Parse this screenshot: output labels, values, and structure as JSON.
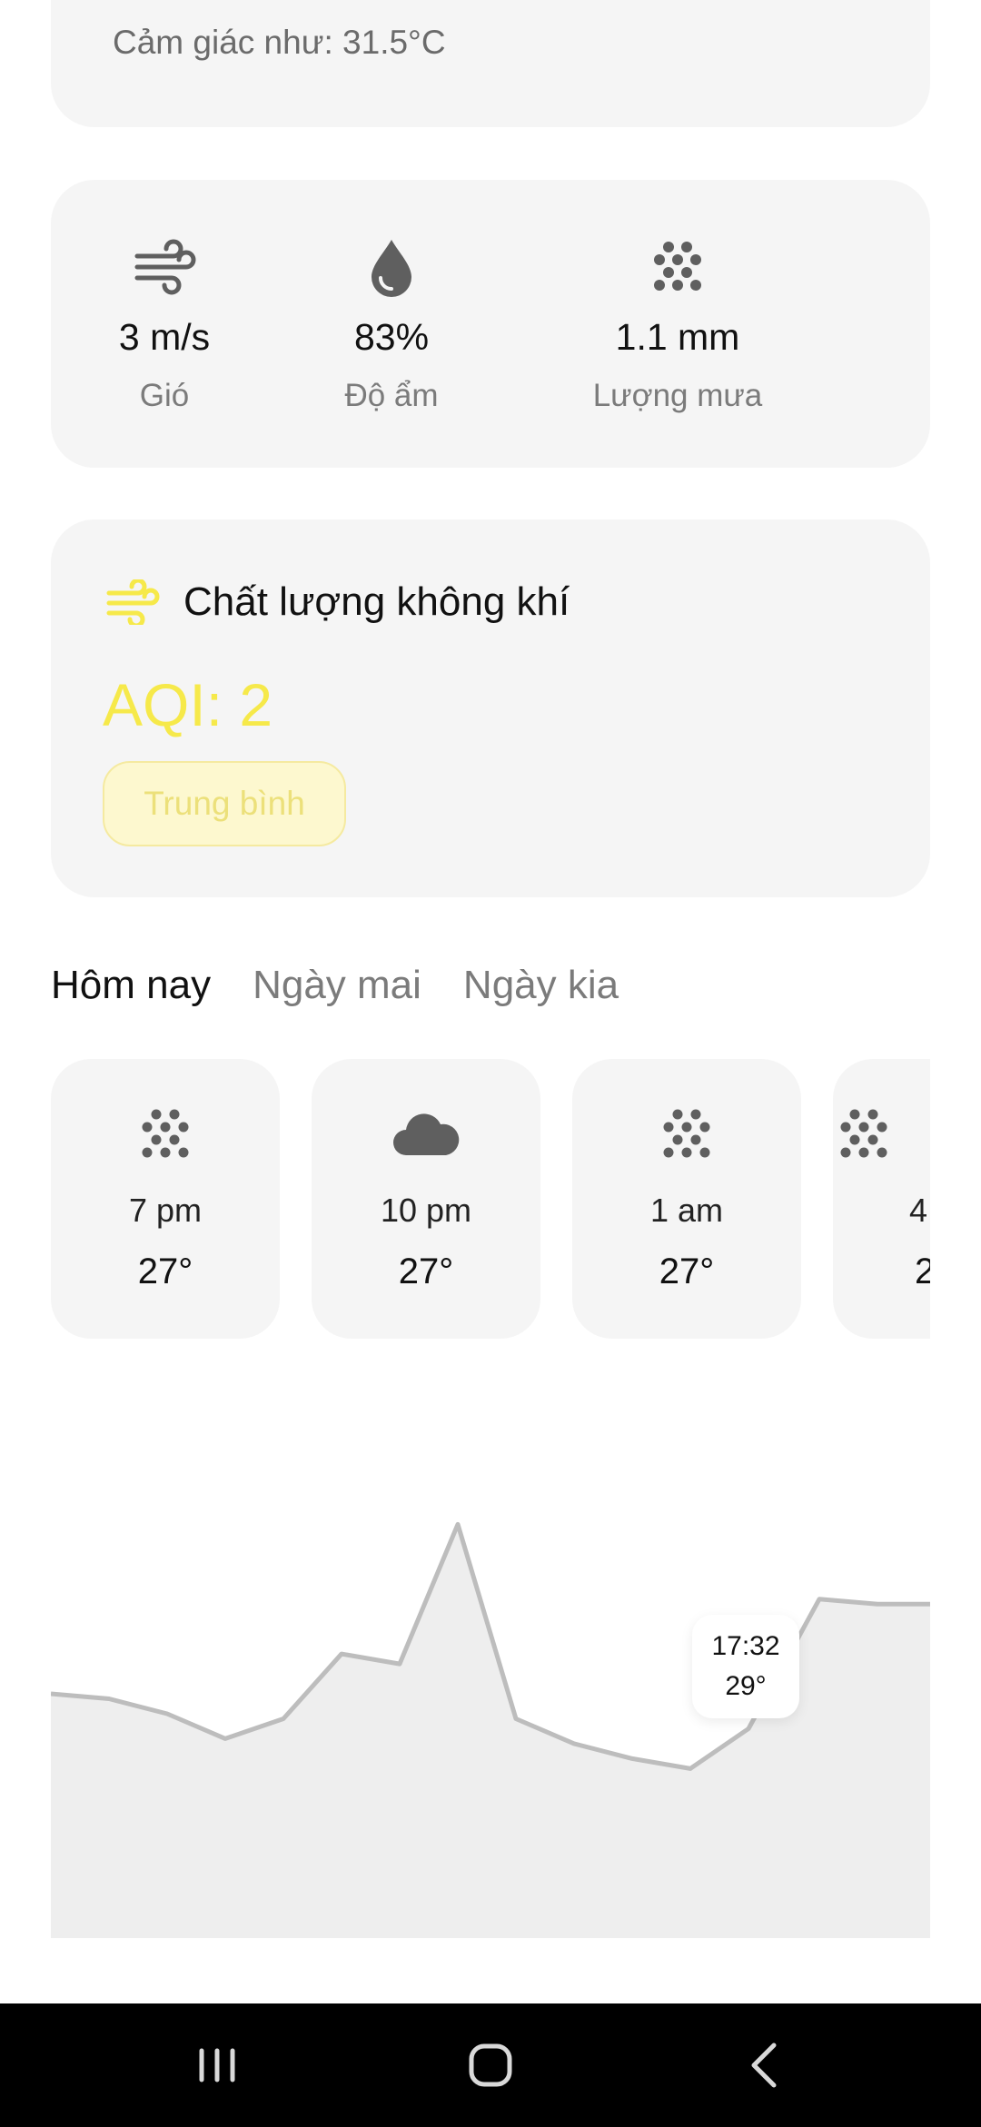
{
  "feels_like": {
    "text": "Cảm giác như: 31.5°C"
  },
  "stats": [
    {
      "icon": "wind-icon",
      "value": "3 m/s",
      "label": "Gió"
    },
    {
      "icon": "humidity-drop-icon",
      "value": "83%",
      "label": "Độ ẩm"
    },
    {
      "icon": "rain-dots-icon",
      "value": "1.1 mm",
      "label": "Lượng mưa"
    }
  ],
  "aqi": {
    "title": "Chất lượng không khí",
    "value": "AQI: 2",
    "badge": "Trung bình",
    "accent_color": "#f6e94a"
  },
  "tabs": [
    {
      "label": "Hôm nay",
      "active": true
    },
    {
      "label": "Ngày mai",
      "active": false
    },
    {
      "label": "Ngày kia",
      "active": false
    }
  ],
  "hourly": [
    {
      "icon": "rain-dots-icon",
      "time": "7 pm",
      "temp": "27°"
    },
    {
      "icon": "cloud-icon",
      "time": "10 pm",
      "temp": "27°"
    },
    {
      "icon": "rain-dots-icon",
      "time": "1 am",
      "temp": "27°"
    },
    {
      "icon": "rain-dots-icon",
      "time": "4",
      "temp": "2"
    }
  ],
  "chart_data": {
    "type": "area",
    "values": [
      27.4,
      27.3,
      27.0,
      26.5,
      26.9,
      28.2,
      28.0,
      30.8,
      26.9,
      26.4,
      26.1,
      25.9,
      26.7,
      29.3,
      29.2,
      29.2
    ],
    "marker": {
      "label_time": "17:32",
      "label_temp": "29°"
    },
    "line_color": "#bdbdbd",
    "fill_color": "#eeeeee"
  },
  "navbar": {
    "buttons": [
      "recent-apps-icon",
      "home-icon",
      "back-icon"
    ]
  }
}
